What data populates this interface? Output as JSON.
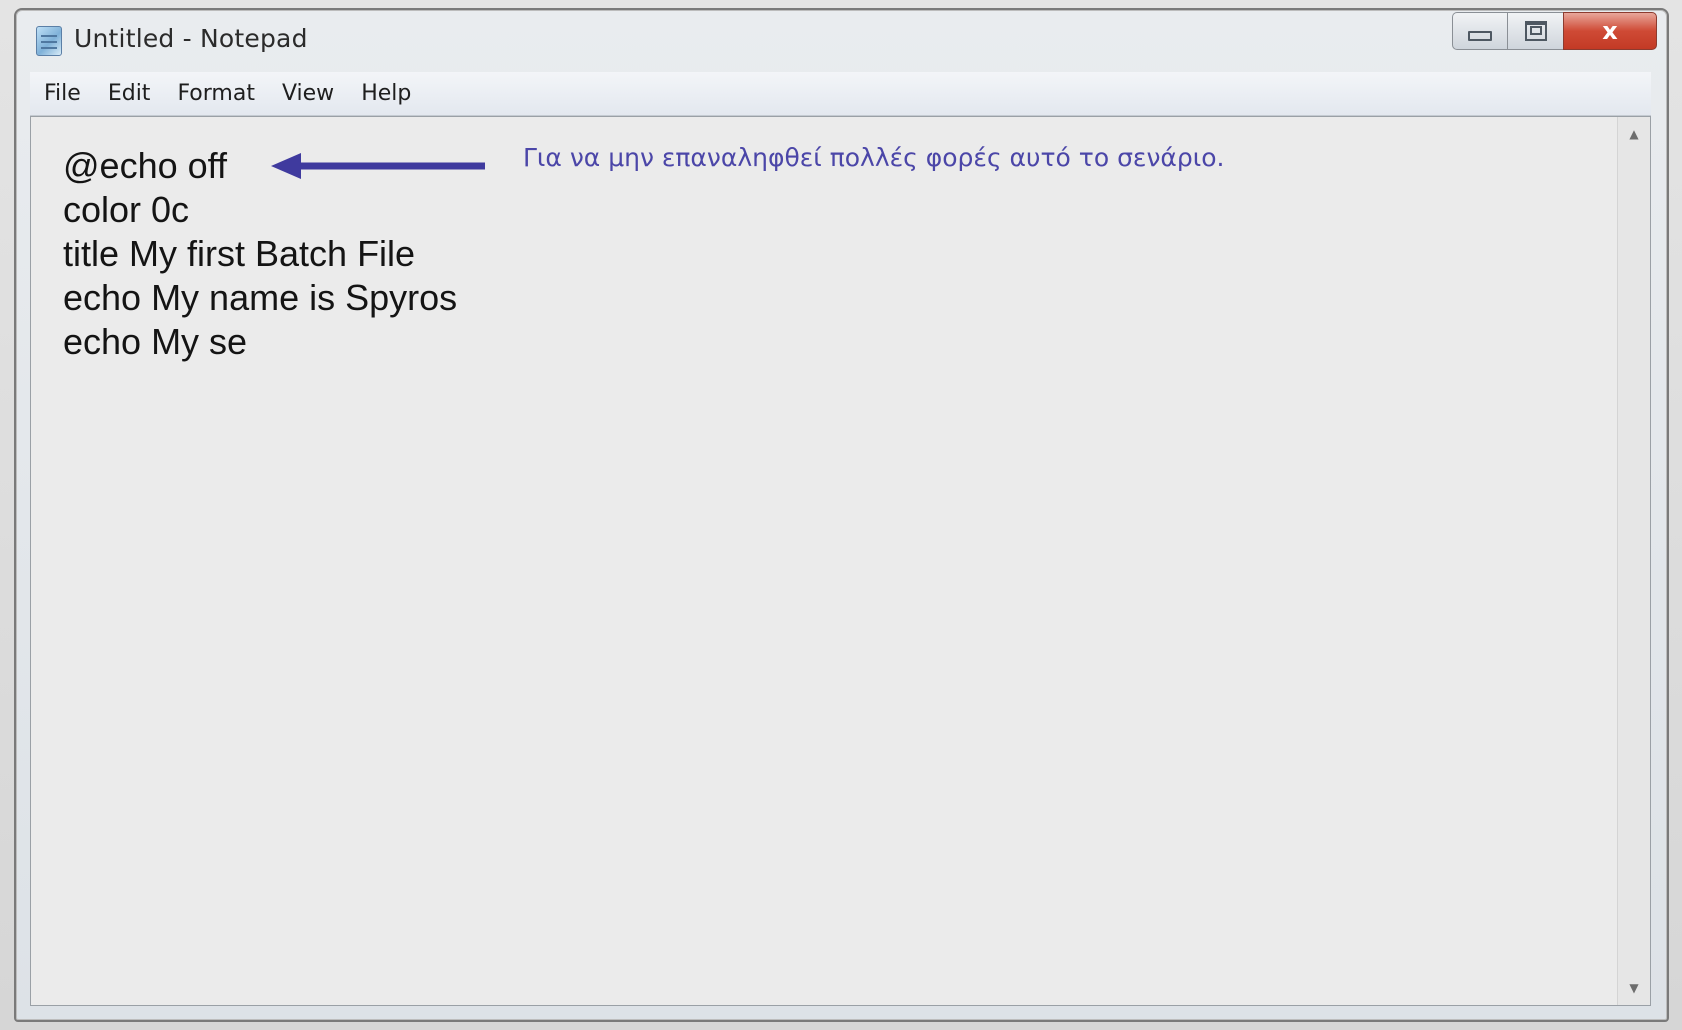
{
  "window": {
    "title": "Untitled - Notepad",
    "controls": {
      "close_glyph": "x"
    }
  },
  "menu": {
    "items": [
      {
        "label": "File"
      },
      {
        "label": "Edit"
      },
      {
        "label": "Format"
      },
      {
        "label": "View"
      },
      {
        "label": "Help"
      }
    ]
  },
  "editor": {
    "lines": [
      "@echo off",
      "color 0c",
      "title My first Batch File",
      "echo My name is Spyros",
      "echo My se"
    ],
    "annotation": {
      "text": "Για να μην επαναληφθεί πολλές φορές αυτό το σενάριο.",
      "color": "#4b46a8",
      "arrow_color": "#3f3a9e",
      "arrow_icon": "left-arrow-icon"
    }
  },
  "scrollbar": {
    "up_icon": "scroll-up-arrow-icon",
    "down_icon": "scroll-down-arrow-icon"
  },
  "colors": {
    "close_button": "#cf4a35",
    "editor_background": "#ebebeb",
    "text": "#141414"
  }
}
